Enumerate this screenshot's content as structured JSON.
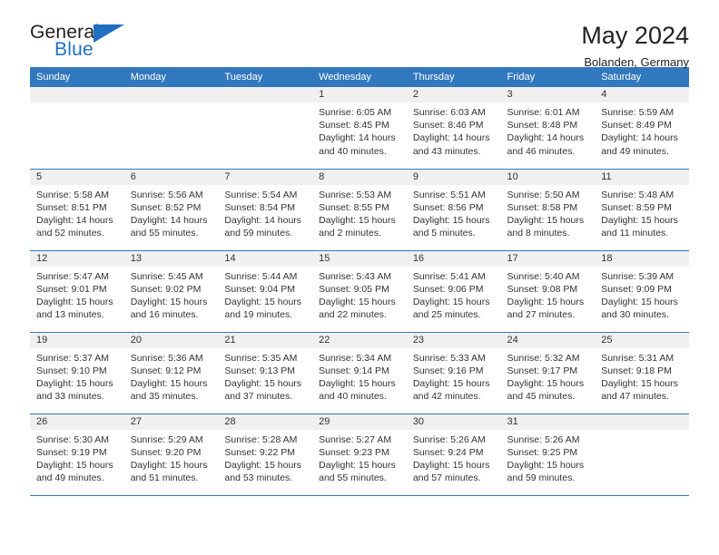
{
  "brand": {
    "name_part1": "General",
    "name_part2": "Blue",
    "primary_color": "#1f70c1"
  },
  "header": {
    "title": "May 2024",
    "subtitle": "Bolanden, Germany"
  },
  "calendar": {
    "header_bg": "#3278be",
    "weekdays": [
      "Sunday",
      "Monday",
      "Tuesday",
      "Wednesday",
      "Thursday",
      "Friday",
      "Saturday"
    ],
    "labels": {
      "sunrise": "Sunrise:",
      "sunset": "Sunset:",
      "daylight": "Daylight:"
    },
    "weeks": [
      [
        {
          "day": "",
          "empty": true
        },
        {
          "day": "",
          "empty": true
        },
        {
          "day": "",
          "empty": true
        },
        {
          "day": "1",
          "sunrise": "Sunrise: 6:05 AM",
          "sunset": "Sunset: 8:45 PM",
          "daylight_line1": "Daylight: 14 hours",
          "daylight_line2": "and 40 minutes."
        },
        {
          "day": "2",
          "sunrise": "Sunrise: 6:03 AM",
          "sunset": "Sunset: 8:46 PM",
          "daylight_line1": "Daylight: 14 hours",
          "daylight_line2": "and 43 minutes."
        },
        {
          "day": "3",
          "sunrise": "Sunrise: 6:01 AM",
          "sunset": "Sunset: 8:48 PM",
          "daylight_line1": "Daylight: 14 hours",
          "daylight_line2": "and 46 minutes."
        },
        {
          "day": "4",
          "sunrise": "Sunrise: 5:59 AM",
          "sunset": "Sunset: 8:49 PM",
          "daylight_line1": "Daylight: 14 hours",
          "daylight_line2": "and 49 minutes."
        }
      ],
      [
        {
          "day": "5",
          "sunrise": "Sunrise: 5:58 AM",
          "sunset": "Sunset: 8:51 PM",
          "daylight_line1": "Daylight: 14 hours",
          "daylight_line2": "and 52 minutes."
        },
        {
          "day": "6",
          "sunrise": "Sunrise: 5:56 AM",
          "sunset": "Sunset: 8:52 PM",
          "daylight_line1": "Daylight: 14 hours",
          "daylight_line2": "and 55 minutes."
        },
        {
          "day": "7",
          "sunrise": "Sunrise: 5:54 AM",
          "sunset": "Sunset: 8:54 PM",
          "daylight_line1": "Daylight: 14 hours",
          "daylight_line2": "and 59 minutes."
        },
        {
          "day": "8",
          "sunrise": "Sunrise: 5:53 AM",
          "sunset": "Sunset: 8:55 PM",
          "daylight_line1": "Daylight: 15 hours",
          "daylight_line2": "and 2 minutes."
        },
        {
          "day": "9",
          "sunrise": "Sunrise: 5:51 AM",
          "sunset": "Sunset: 8:56 PM",
          "daylight_line1": "Daylight: 15 hours",
          "daylight_line2": "and 5 minutes."
        },
        {
          "day": "10",
          "sunrise": "Sunrise: 5:50 AM",
          "sunset": "Sunset: 8:58 PM",
          "daylight_line1": "Daylight: 15 hours",
          "daylight_line2": "and 8 minutes."
        },
        {
          "day": "11",
          "sunrise": "Sunrise: 5:48 AM",
          "sunset": "Sunset: 8:59 PM",
          "daylight_line1": "Daylight: 15 hours",
          "daylight_line2": "and 11 minutes."
        }
      ],
      [
        {
          "day": "12",
          "sunrise": "Sunrise: 5:47 AM",
          "sunset": "Sunset: 9:01 PM",
          "daylight_line1": "Daylight: 15 hours",
          "daylight_line2": "and 13 minutes."
        },
        {
          "day": "13",
          "sunrise": "Sunrise: 5:45 AM",
          "sunset": "Sunset: 9:02 PM",
          "daylight_line1": "Daylight: 15 hours",
          "daylight_line2": "and 16 minutes."
        },
        {
          "day": "14",
          "sunrise": "Sunrise: 5:44 AM",
          "sunset": "Sunset: 9:04 PM",
          "daylight_line1": "Daylight: 15 hours",
          "daylight_line2": "and 19 minutes."
        },
        {
          "day": "15",
          "sunrise": "Sunrise: 5:43 AM",
          "sunset": "Sunset: 9:05 PM",
          "daylight_line1": "Daylight: 15 hours",
          "daylight_line2": "and 22 minutes."
        },
        {
          "day": "16",
          "sunrise": "Sunrise: 5:41 AM",
          "sunset": "Sunset: 9:06 PM",
          "daylight_line1": "Daylight: 15 hours",
          "daylight_line2": "and 25 minutes."
        },
        {
          "day": "17",
          "sunrise": "Sunrise: 5:40 AM",
          "sunset": "Sunset: 9:08 PM",
          "daylight_line1": "Daylight: 15 hours",
          "daylight_line2": "and 27 minutes."
        },
        {
          "day": "18",
          "sunrise": "Sunrise: 5:39 AM",
          "sunset": "Sunset: 9:09 PM",
          "daylight_line1": "Daylight: 15 hours",
          "daylight_line2": "and 30 minutes."
        }
      ],
      [
        {
          "day": "19",
          "sunrise": "Sunrise: 5:37 AM",
          "sunset": "Sunset: 9:10 PM",
          "daylight_line1": "Daylight: 15 hours",
          "daylight_line2": "and 33 minutes."
        },
        {
          "day": "20",
          "sunrise": "Sunrise: 5:36 AM",
          "sunset": "Sunset: 9:12 PM",
          "daylight_line1": "Daylight: 15 hours",
          "daylight_line2": "and 35 minutes."
        },
        {
          "day": "21",
          "sunrise": "Sunrise: 5:35 AM",
          "sunset": "Sunset: 9:13 PM",
          "daylight_line1": "Daylight: 15 hours",
          "daylight_line2": "and 37 minutes."
        },
        {
          "day": "22",
          "sunrise": "Sunrise: 5:34 AM",
          "sunset": "Sunset: 9:14 PM",
          "daylight_line1": "Daylight: 15 hours",
          "daylight_line2": "and 40 minutes."
        },
        {
          "day": "23",
          "sunrise": "Sunrise: 5:33 AM",
          "sunset": "Sunset: 9:16 PM",
          "daylight_line1": "Daylight: 15 hours",
          "daylight_line2": "and 42 minutes."
        },
        {
          "day": "24",
          "sunrise": "Sunrise: 5:32 AM",
          "sunset": "Sunset: 9:17 PM",
          "daylight_line1": "Daylight: 15 hours",
          "daylight_line2": "and 45 minutes."
        },
        {
          "day": "25",
          "sunrise": "Sunrise: 5:31 AM",
          "sunset": "Sunset: 9:18 PM",
          "daylight_line1": "Daylight: 15 hours",
          "daylight_line2": "and 47 minutes."
        }
      ],
      [
        {
          "day": "26",
          "sunrise": "Sunrise: 5:30 AM",
          "sunset": "Sunset: 9:19 PM",
          "daylight_line1": "Daylight: 15 hours",
          "daylight_line2": "and 49 minutes."
        },
        {
          "day": "27",
          "sunrise": "Sunrise: 5:29 AM",
          "sunset": "Sunset: 9:20 PM",
          "daylight_line1": "Daylight: 15 hours",
          "daylight_line2": "and 51 minutes."
        },
        {
          "day": "28",
          "sunrise": "Sunrise: 5:28 AM",
          "sunset": "Sunset: 9:22 PM",
          "daylight_line1": "Daylight: 15 hours",
          "daylight_line2": "and 53 minutes."
        },
        {
          "day": "29",
          "sunrise": "Sunrise: 5:27 AM",
          "sunset": "Sunset: 9:23 PM",
          "daylight_line1": "Daylight: 15 hours",
          "daylight_line2": "and 55 minutes."
        },
        {
          "day": "30",
          "sunrise": "Sunrise: 5:26 AM",
          "sunset": "Sunset: 9:24 PM",
          "daylight_line1": "Daylight: 15 hours",
          "daylight_line2": "and 57 minutes."
        },
        {
          "day": "31",
          "sunrise": "Sunrise: 5:26 AM",
          "sunset": "Sunset: 9:25 PM",
          "daylight_line1": "Daylight: 15 hours",
          "daylight_line2": "and 59 minutes."
        },
        {
          "day": "",
          "empty": true
        }
      ]
    ]
  }
}
